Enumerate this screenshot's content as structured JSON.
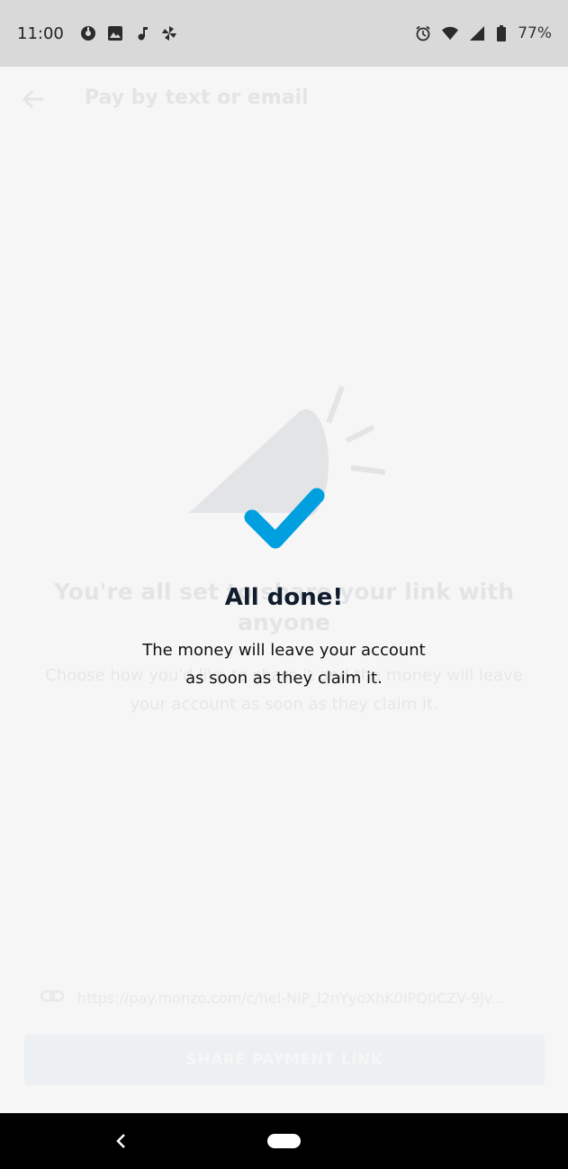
{
  "status_bar": {
    "time": "11:00",
    "left_icons": [
      "podcast-icon",
      "image-icon",
      "music-note-icon",
      "pinwheel-icon"
    ],
    "right_icons": [
      "alarm-icon",
      "wifi-icon",
      "signal-icon",
      "battery-icon"
    ],
    "battery": "77%"
  },
  "background_page": {
    "title": "Pay by text or email",
    "heading": "You're all set to share your link with anyone",
    "description": "Choose how you'd like to share it and the money will leave your account as soon as they claim it.",
    "link": "https://pay.monzo.com/c/hel-NIP_l2nYyoXhK0IPQ0CZV-9jv...",
    "share_button": "SHARE PAYMENT LINK"
  },
  "success": {
    "title": "All done!",
    "line1": "The money will leave your account",
    "line2": "as soon as they claim it."
  },
  "colors": {
    "accent": "#00a0e0",
    "title": "#111c2c",
    "status_bar": "#d9d9d9"
  }
}
